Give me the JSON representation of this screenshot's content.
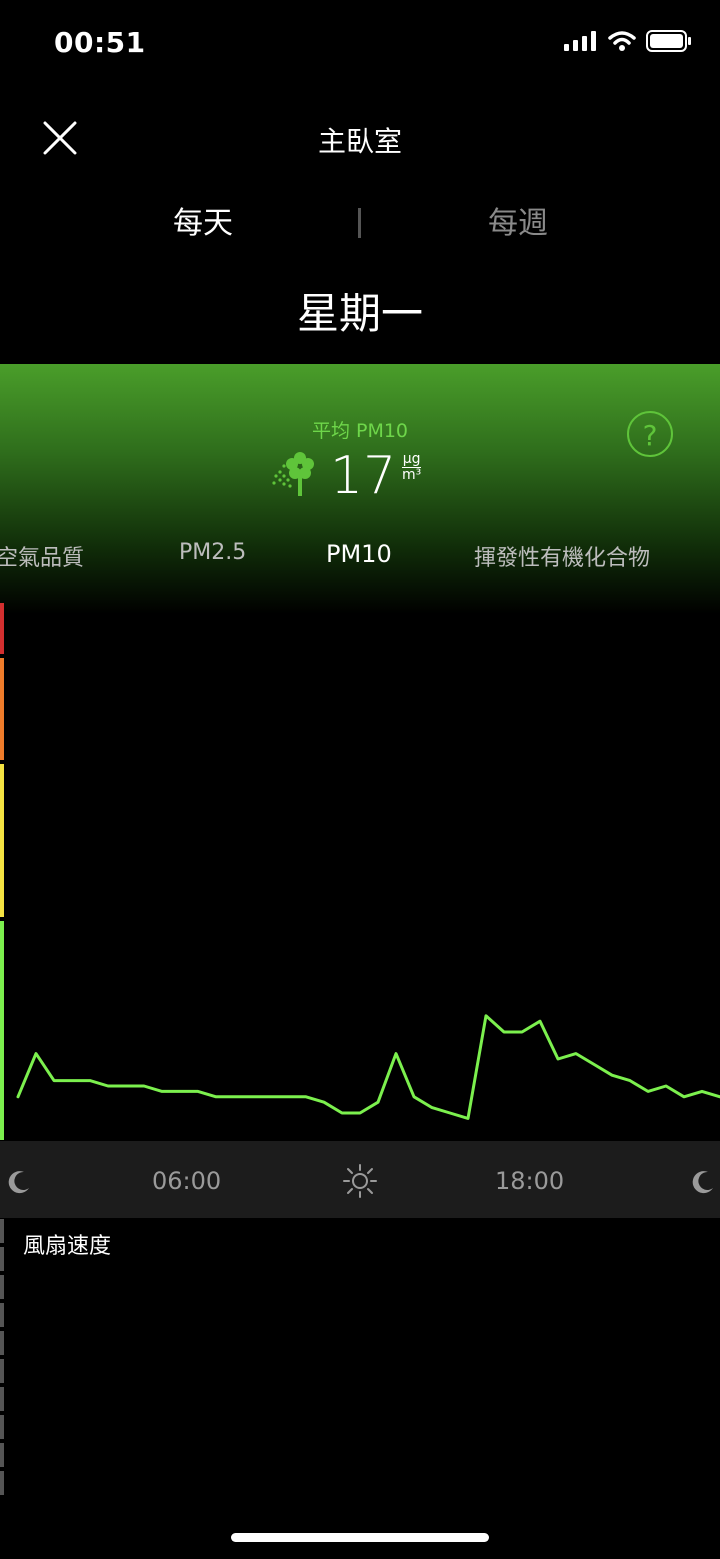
{
  "status_bar": {
    "time": "00:51"
  },
  "header": {
    "room": "主臥室",
    "close_icon": "close-icon"
  },
  "tabs": {
    "daily": "每天",
    "weekly": "每週"
  },
  "day_title": "星期一",
  "summary": {
    "label": "平均 PM10",
    "value": "17",
    "unit_top": "μg",
    "unit_bottom": "m³",
    "help": "?"
  },
  "metric_tabs": [
    "空氣品質",
    "PM2.5",
    "PM10",
    "揮發性有機化合物"
  ],
  "selected_metric": "PM10",
  "colors": {
    "accent": "#7cf04e",
    "panel_green": "#4a9e2a",
    "red": "#d32f2f",
    "orange": "#f07c2a",
    "yellow": "#f5e342",
    "green": "#7cf04e"
  },
  "chart_data": {
    "type": "line",
    "series": [
      {
        "values": [
          0.08,
          0.16,
          0.11,
          0.11,
          0.11,
          0.1,
          0.1,
          0.1,
          0.09,
          0.09,
          0.09,
          0.08,
          0.08,
          0.08,
          0.08,
          0.08,
          0.08,
          0.07,
          0.05,
          0.05,
          0.07,
          0.16,
          0.08,
          0.06,
          0.05,
          0.04,
          0.23,
          0.2,
          0.2,
          0.22,
          0.15,
          0.16,
          0.14,
          0.12,
          0.11,
          0.09,
          0.1,
          0.08,
          0.09,
          0.08
        ]
      }
    ]
  },
  "time_axis": {
    "ticks": [
      "06:00",
      "18:00"
    ],
    "icons": [
      "moon-icon",
      "sun-icon",
      "moon-icon"
    ]
  },
  "fan": {
    "label": "風扇速度"
  }
}
